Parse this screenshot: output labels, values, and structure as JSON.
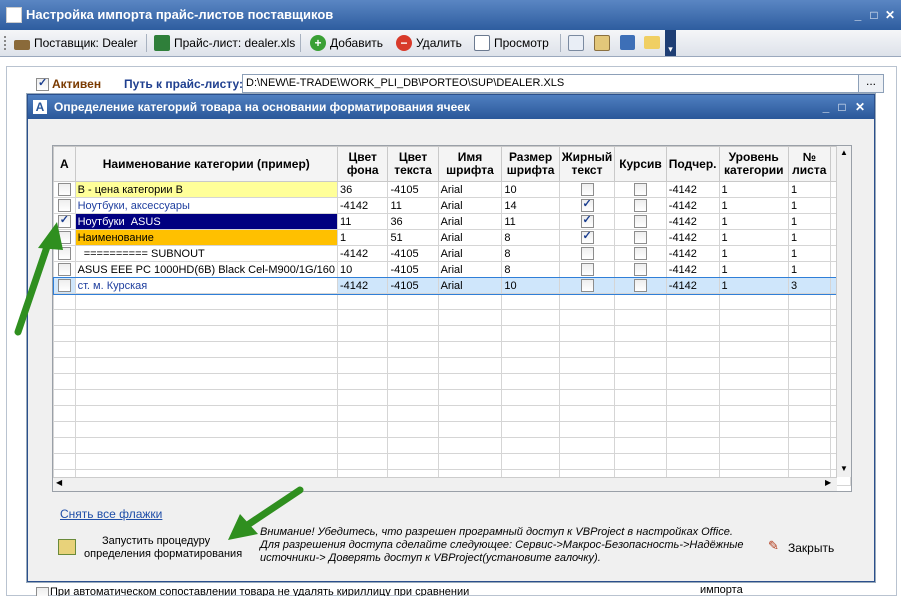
{
  "window": {
    "title": "Настройка импорта прайс-листов поставщиков",
    "controls": [
      "_",
      "□",
      "✕"
    ]
  },
  "toolbar": {
    "supplier_label": "Поставщик: Dealer",
    "pricelist_label": "Прайс-лист: dealer.xls",
    "add_label": "Добавить",
    "delete_label": "Удалить",
    "view_label": "Просмотр"
  },
  "settings": {
    "active_label": "Активен",
    "path_label": "Путь к прайс-листу:",
    "path_value": "D:\\NEW\\E-TRADE\\WORK_PLI_DB\\PORTEO\\SUP\\DEALER.XLS",
    "browse_label": "..."
  },
  "dialog": {
    "title": "Определение категорий товара на основании форматирования ячеек",
    "controls": [
      "_",
      "□",
      "✕"
    ],
    "columns": [
      "А",
      "Наименование категории (пример)",
      "Цвет фона",
      "Цвет текста",
      "Имя шрифта",
      "Размер шрифта",
      "Жирный текст",
      "Курсив",
      "Подчер.",
      "Уровень категории",
      "№ листа"
    ],
    "rows": [
      {
        "a": false,
        "name": "В - цена категории В",
        "bg": "36",
        "fg": "-4105",
        "font": "Arial",
        "size": "10",
        "bold": false,
        "italic": false,
        "underline": "-4142",
        "level": "1",
        "sheet": "1"
      },
      {
        "a": false,
        "name": "Ноутбуки, аксессуары",
        "bg": "-4142",
        "fg": "11",
        "font": "Arial",
        "size": "14",
        "bold": true,
        "italic": false,
        "underline": "-4142",
        "level": "1",
        "sheet": "1"
      },
      {
        "a": true,
        "name": "Ноутбуки  ASUS",
        "bg": "11",
        "fg": "36",
        "font": "Arial",
        "size": "11",
        "bold": true,
        "italic": false,
        "underline": "-4142",
        "level": "1",
        "sheet": "1"
      },
      {
        "a": false,
        "name": "Наименование",
        "bg": "1",
        "fg": "51",
        "font": "Arial",
        "size": "8",
        "bold": true,
        "italic": false,
        "underline": "-4142",
        "level": "1",
        "sheet": "1"
      },
      {
        "a": false,
        "name": "  ========== SUBNOUT",
        "bg": "-4142",
        "fg": "-4105",
        "font": "Arial",
        "size": "8",
        "bold": false,
        "italic": false,
        "underline": "-4142",
        "level": "1",
        "sheet": "1"
      },
      {
        "a": false,
        "name": "ASUS EEE PC 1000HD(6B) Black Cel-M900/1G/160",
        "bg": "10",
        "fg": "-4105",
        "font": "Arial",
        "size": "8",
        "bold": false,
        "italic": false,
        "underline": "-4142",
        "level": "1",
        "sheet": "1"
      },
      {
        "a": false,
        "name": "ст. м. Курская",
        "bg": "-4142",
        "fg": "-4105",
        "font": "Arial",
        "size": "10",
        "bold": false,
        "italic": false,
        "underline": "-4142",
        "level": "1",
        "sheet": "3"
      }
    ],
    "clear_flags_label": "Снять все флажки",
    "run_label_line1": "Запустить процедуру",
    "run_label_line2": "определения форматирования",
    "warning_text": "Внимание! Убедитесь, что разрешен програмный доступ к VBProject в настройках Office. Для разрешения доступа сделайте следующее: Сервис->Макрос-Безопасность->Надёжные источники-> Доверять доступ к VBProject(установите галочку).",
    "close_label": "Закрыть"
  },
  "bottom": {
    "checkbox_text": "При автоматическом сопоставлении товара не удалять кириллицу при сравнении",
    "right_text": "импорта"
  },
  "colors": {
    "row_yellow": "#ffff99",
    "row_navy": "#000080",
    "row_orange": "#ffc000",
    "row_selected": "#cfe6fb",
    "arrow_green": "#2f8f1f"
  }
}
